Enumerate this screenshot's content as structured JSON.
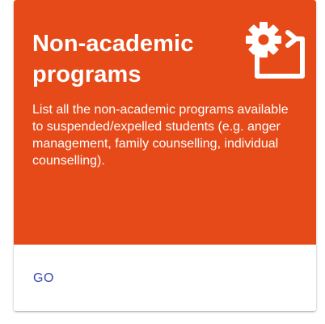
{
  "card": {
    "title": "Non-academic programs",
    "description": "List all the non-academic programs available to suspended/expelled students (e.g. anger management, family counselling, individual counselling).",
    "icon": "settings-applications-icon",
    "action_label": "GO"
  },
  "colors": {
    "header_background": "#e64a19",
    "header_text": "#ffffff",
    "action_text": "#3949ab",
    "card_background": "#ffffff"
  }
}
